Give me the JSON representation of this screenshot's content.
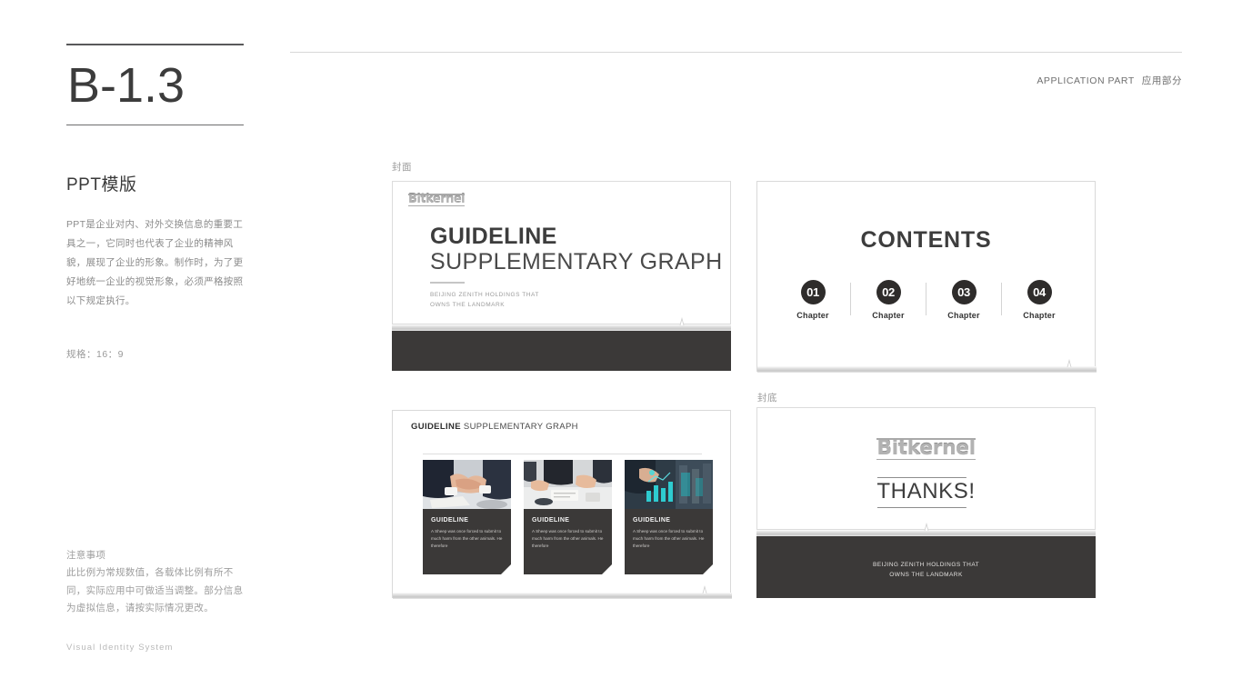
{
  "header": {
    "rule_visible": true,
    "section_code": "B-1.3",
    "right_label_en": "APPLICATION PART",
    "right_label_cn": "应用部分"
  },
  "sidebar": {
    "title": "PPT模版",
    "body": "PPT是企业对内、对外交换信息的重要工具之一，它同时也代表了企业的精神风貌，展现了企业的形象。制作时，为了更好地统一企业的视觉形象，必须严格按照以下规定执行。",
    "spec": "规格：16：9",
    "notes_title": "注意事项",
    "notes_body": "此比例为常规数值，各载体比例有所不同，实际应用中可做适当调整。部分信息为虚拟信息，请按实际情况更改。",
    "footer": "Visual Identity System"
  },
  "captions": {
    "cover": "封面",
    "back": "封底"
  },
  "brand": {
    "logo_text": "Bitkernel",
    "dark": "#3b3938",
    "ledge": "#c7c7c7",
    "text_dark": "#3d3d3d",
    "text_muted": "#9d9d9d"
  },
  "slides": {
    "cover": {
      "logo": "Bitkernel",
      "title_main": "GUIDELINE",
      "title_sub": "SUPPLEMENTARY GRAPH",
      "subtitle_line1": "BEIJING ZENITH HOLDINGS THAT",
      "subtitle_line2": "OWNS THE LANDMARK"
    },
    "contents": {
      "title": "CONTENTS",
      "chapters": [
        {
          "number": "01",
          "label": "Chapter"
        },
        {
          "number": "02",
          "label": "Chapter"
        },
        {
          "number": "03",
          "label": "Chapter"
        },
        {
          "number": "04",
          "label": "Chapter"
        }
      ]
    },
    "cards": {
      "title_bold": "GUIDELINE",
      "title_rest": " SUPPLEMENTARY GRAPH",
      "items": [
        {
          "photo": "handshake-photo",
          "heading": "GUIDELINE",
          "text": "A Sheep was once forced to submit to much harm from the other animals. He therefore"
        },
        {
          "photo": "meeting-photo",
          "heading": "GUIDELINE",
          "text": "A Sheep was once forced to submit to much harm from the other animals. He therefore"
        },
        {
          "photo": "data-chart-photo",
          "heading": "GUIDELINE",
          "text": "A Sheep was once forced to submit to much harm from the other animals. He therefore"
        }
      ]
    },
    "back": {
      "logo": "Bitkernel",
      "thanks": "THANKS!",
      "footer_line1": "BEIJING ZENITH HOLDINGS THAT",
      "footer_line2": "OWNS THE LANDMARK"
    }
  }
}
